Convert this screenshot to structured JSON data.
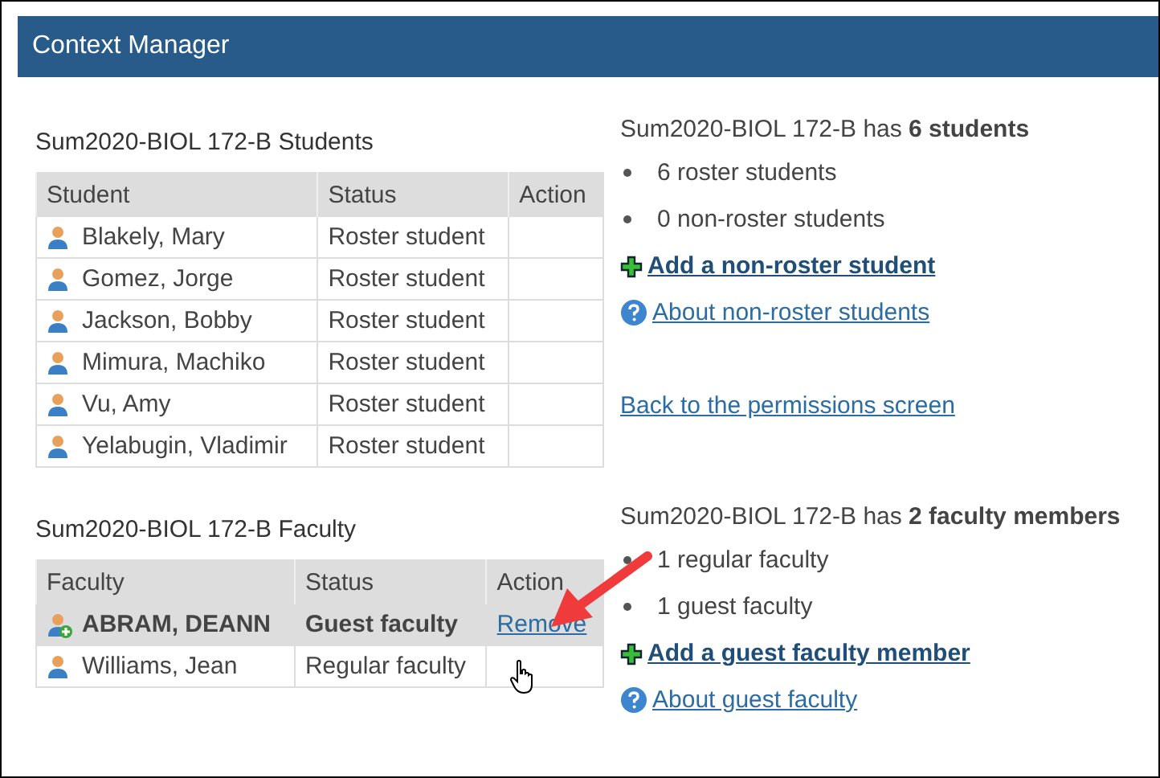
{
  "window": {
    "title": "Context Manager"
  },
  "sections": [
    {
      "title": "Sum2020-BIOL 172-B Students",
      "columns": [
        "Student",
        "Status",
        "Action"
      ],
      "rows": [
        {
          "kind": "member",
          "name": "Blakely, Mary",
          "status": "Roster student",
          "selected": false
        },
        {
          "kind": "member",
          "name": "Gomez, Jorge",
          "status": "Roster student",
          "selected": false
        },
        {
          "kind": "member",
          "name": "Jackson, Bobby",
          "status": "Roster student",
          "selected": false
        },
        {
          "kind": "member",
          "name": "Mimura, Machiko",
          "status": "Roster student",
          "selected": false
        },
        {
          "kind": "member",
          "name": "Vu, Amy",
          "status": "Roster student",
          "selected": false
        },
        {
          "kind": "member",
          "name": "Yelabugin, Vladimir",
          "status": "Roster student",
          "selected": false
        }
      ],
      "summary": {
        "heading": "Sum2020-BIOL 172-B has **6 students**",
        "items": [
          "6 roster students",
          "0 non-roster students"
        ],
        "links": [
          {
            "kind": "add",
            "label": "Add a non-roster student"
          },
          {
            "kind": "help",
            "label": "About non-roster students"
          },
          {
            "kind": "plain",
            "label": "Back to the permissions screen"
          }
        ]
      }
    },
    {
      "title": "Sum2020-BIOL 172-B Faculty",
      "columns": [
        "Faculty",
        "Status",
        "Action"
      ],
      "rows": [
        {
          "kind": "guest",
          "name": "ABRAM, DEANN",
          "status": "Guest faculty",
          "action": "Remove",
          "selected": true
        },
        {
          "kind": "member",
          "name": "Williams, Jean",
          "status": "Regular faculty",
          "selected": false
        }
      ],
      "summary": {
        "heading": "Sum2020-BIOL 172-B has **2 faculty members**",
        "items": [
          "1 regular faculty",
          "1 guest faculty"
        ],
        "links": [
          {
            "kind": "add",
            "label": "Add a guest faculty member"
          },
          {
            "kind": "help",
            "label": "About guest faculty"
          }
        ]
      }
    }
  ]
}
